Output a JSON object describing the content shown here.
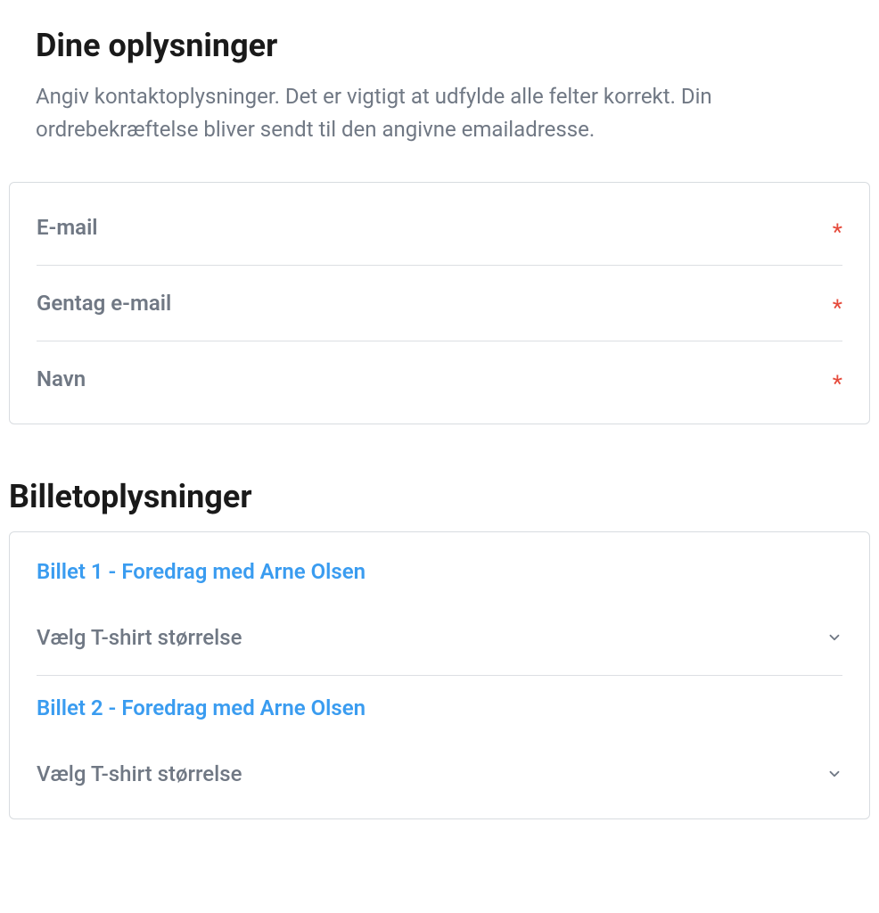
{
  "contact": {
    "heading": "Dine oplysninger",
    "subtext": "Angiv kontaktoplysninger. Det er vigtigt at udfylde alle felter korrekt. Din ordrebekræftelse bliver sendt til den angivne emailadresse.",
    "fields": {
      "email": {
        "label": "E-mail",
        "required": "*"
      },
      "email_repeat": {
        "label": "Gentag e-mail",
        "required": "*"
      },
      "name": {
        "label": "Navn",
        "required": "*"
      }
    }
  },
  "tickets": {
    "heading": "Billetoplysninger",
    "items": [
      {
        "title": "Billet 1 - Foredrag med Arne Olsen",
        "select_label": "Vælg T-shirt størrelse"
      },
      {
        "title": "Billet 2 - Foredrag med Arne Olsen",
        "select_label": "Vælg T-shirt størrelse"
      }
    ]
  }
}
